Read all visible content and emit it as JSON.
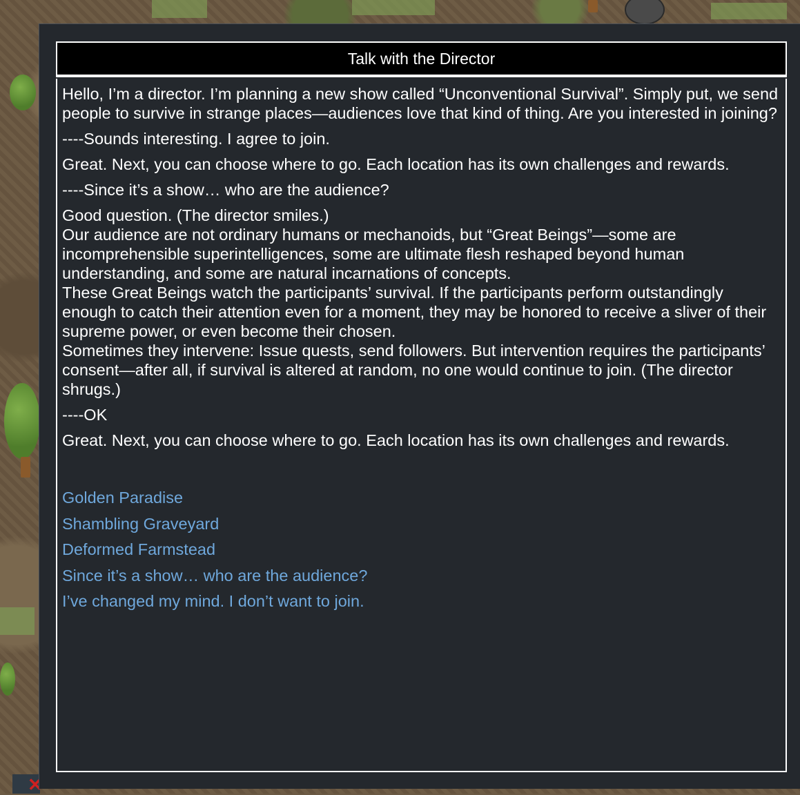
{
  "dialog": {
    "title": "Talk with the Director",
    "messages": [
      {
        "speaker": "director",
        "lines": [
          "Hello, I’m a director. I’m planning a new show called “Unconventional Survival”. Simply put, we send people to survive in strange places—audiences love that kind of thing. Are you interested in joining?"
        ]
      },
      {
        "speaker": "player",
        "lines": [
          "----Sounds interesting. I agree to join."
        ]
      },
      {
        "speaker": "director",
        "lines": [
          "Great. Next, you can choose where to go. Each location has its own challenges and rewards."
        ]
      },
      {
        "speaker": "player",
        "lines": [
          "----Since it’s a show… who are the audience?"
        ]
      },
      {
        "speaker": "director",
        "lines": [
          "Good question. (The director smiles.)",
          "Our audience are not ordinary humans or mechanoids, but “Great Beings”—some are incomprehensible superintelligences, some are ultimate flesh reshaped beyond human understanding, and some are natural incarnations of concepts.",
          "These Great Beings watch the participants’ survival. If the participants perform outstandingly enough to catch their attention even for a moment, they may be honored to receive a sliver of their supreme power, or even become their chosen.",
          "Sometimes they intervene: Issue quests, send followers. But intervention requires the participants’ consent—after all, if survival is altered at random, no one would continue to join. (The director shrugs.)"
        ]
      },
      {
        "speaker": "player",
        "lines": [
          "----OK"
        ]
      },
      {
        "speaker": "director",
        "lines": [
          "Great. Next, you can choose where to go. Each location has its own challenges and rewards."
        ]
      }
    ],
    "options": [
      "Golden Paradise",
      "Shambling Graveyard",
      "Deformed Farmstead",
      "Since it’s a show… who are the audience?",
      "I’ve changed my mind. I don’t want to join."
    ]
  },
  "colors": {
    "option_link": "#6fa8dc",
    "window_bg": "#24282d",
    "title_bg": "#000000"
  }
}
